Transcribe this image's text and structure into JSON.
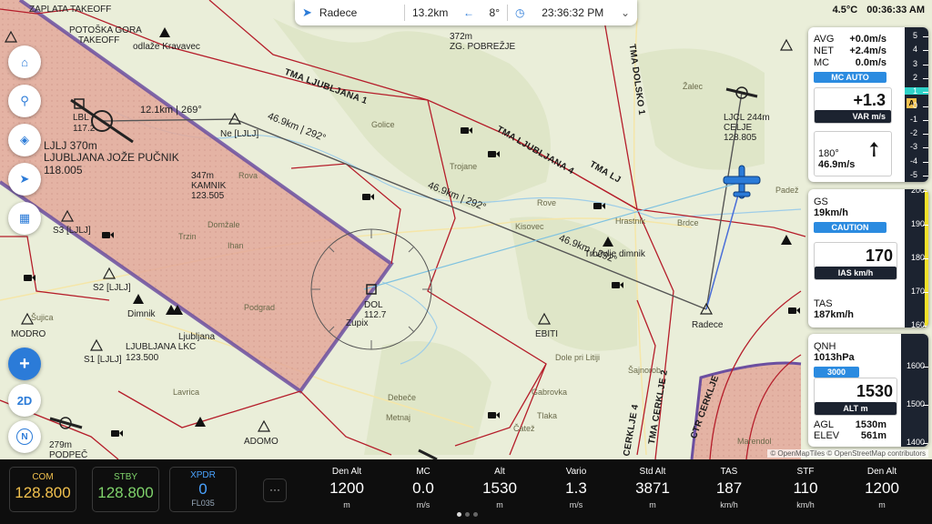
{
  "topbar": {
    "destination": "Radece",
    "distance": "13.2km",
    "bearing": "8°",
    "time": "23:36:32 PM"
  },
  "status": {
    "temperature": "4.5°C",
    "clock": "00:36:33 AM"
  },
  "map_labels": {
    "zaplata": "ZAPLATA TAKEOFF",
    "potoska": "POTOŠKA GORA",
    "potoska2": "TAKEOFF",
    "odlaze": "odlaže Kravavec",
    "lbl": "LBL",
    "lbl_freq": "117.2",
    "ljlj": "LJLJ 370m",
    "ljlj_name": "LJUBLJANA JOŽE PUČNIK",
    "ljlj_freq": "118.005",
    "ne": "Ne [LJLJ]",
    "kamnik_alt": "347m",
    "kamnik": "KAMNIK",
    "kamnik_freq": "123.505",
    "s3": "S3 [LJLJ]",
    "s2": "S2 [LJLJ]",
    "s1": "S1 [LJLJ]",
    "dimnik": "Dimnik",
    "ljubljana_lkc": "LJUBLJANA LKC",
    "ljubljana_freq": "123.500",
    "ljubljana_1": "Ljubljana",
    "modro": "MODRO",
    "podpec_alt": "279m",
    "podpec": "PODPEČ",
    "adomo": "ADOMO",
    "zg_alt": "372m",
    "zg": "ZG. POBREŽJE",
    "ljcl_alt": "LJCL 244m",
    "celje": "CELJE",
    "celje_freq": "128.805",
    "dol": "DOL",
    "dol_freq": "112.7",
    "zupix": "Zupix",
    "ebiti": "EBITI",
    "radece": "Radece",
    "trbovlje": "Trbovlje dimnik",
    "tma1": "TMA LJUBLJANA 1",
    "tma4": "TMA LJUBLJANA 4",
    "tma_lj": "TMA LJ",
    "tma_dolsko": "TMA DOLSKO 1",
    "tma_cerklje2": "TMA CERKLJE 2",
    "tma_cerklje": "CTR CERKLJE",
    "tma_cerklje4": "TMA CERKLJE 4",
    "town_golice": "Golice",
    "town_domzale": "Domžale",
    "town_trzin": "Trzin",
    "town_ihan": "Ihan",
    "town_podgrad": "Podgrad",
    "town_kisovec": "Kisovec",
    "town_hrastnik": "Hrastnik",
    "town_sevnica": "Padež",
    "town_metnaj": "Metnaj",
    "town_gabrovka": "Gabrovka",
    "town_tlaka": "Tlaka",
    "town_cater": "Čatež",
    "town_debece": "Debeče",
    "town_lavrica": "Lavrica",
    "town_sujica": "Šujica",
    "town_rova": "Rova",
    "town_rove": "Rove",
    "town_zalec": "Žalec",
    "town_marendol": "Marendol",
    "town_trojane": "Trojane",
    "town_brdce": "Brdce",
    "town_dole": "Dole pri Litiji",
    "town_sajnorob": "Šajnorob"
  },
  "route": {
    "leg1": "12.1km | 269°",
    "leg2": "46.9km | 292°",
    "leg3": "46.9km | 292°",
    "leg4": "46.9km | 292°"
  },
  "vario_panel": {
    "avg_label": "AVG",
    "avg": "+0.0m/s",
    "net_label": "NET",
    "net": "+2.4m/s",
    "mc_label": "MC",
    "mc": "0.0m/s",
    "mc_auto": "MC AUTO",
    "var_value": "+1.3",
    "var_unit": "VAR m/s",
    "wind_dir": "180°",
    "wind_speed": "46.9m/s",
    "tape": [
      "5",
      "4",
      "3",
      "2",
      "1",
      "0",
      "-1",
      "-2",
      "-3",
      "-4",
      "-5"
    ],
    "tape_marker": "A"
  },
  "speed_panel": {
    "gs_label": "GS",
    "gs": "19km/h",
    "caution": "CAUTION",
    "ias_value": "170",
    "ias_unit": "IAS km/h",
    "tas_label": "TAS",
    "tas": "187km/h",
    "tape": [
      "200",
      "190",
      "180",
      "170",
      "160"
    ]
  },
  "alt_panel": {
    "qnh_label": "QNH",
    "qnh": "1013hPa",
    "alt_bug": "3000",
    "alt_value": "1530",
    "alt_unit": "ALT m",
    "agl_label": "AGL",
    "agl": "1530m",
    "elev_label": "ELEV",
    "elev": "561m",
    "tape": [
      "1600",
      "1500",
      "1400"
    ]
  },
  "buttons": {
    "zoom_2d": "2D",
    "north": "N"
  },
  "radios": {
    "com_label": "COM",
    "com": "128.800",
    "stby_label": "STBY",
    "stby": "128.800",
    "xpdr_label": "XPDR",
    "xpdr": "0",
    "xpdr_fl": "FL035",
    "more": "···"
  },
  "metrics": [
    {
      "label": "Den Alt",
      "value": "1200",
      "unit": "m"
    },
    {
      "label": "MC",
      "value": "0.0",
      "unit": "m/s"
    },
    {
      "label": "Alt",
      "value": "1530",
      "unit": "m"
    },
    {
      "label": "Vario",
      "value": "1.3",
      "unit": "m/s"
    },
    {
      "label": "Std Alt",
      "value": "3871",
      "unit": "m"
    },
    {
      "label": "TAS",
      "value": "187",
      "unit": "km/h"
    },
    {
      "label": "STF",
      "value": "110",
      "unit": "km/h"
    },
    {
      "label": "Den Alt",
      "value": "1200",
      "unit": "m"
    }
  ],
  "attribution": "© OpenMapTiles © OpenStreetMap contributors",
  "colors": {
    "airspace_fill": "#e3a89a",
    "airspace_border_purple": "#6b4fa0",
    "tma_line": "#b51d2a",
    "accent_blue": "#2b7bd8",
    "radio_com": "#f2c14e",
    "radio_stby": "#7fd36b",
    "radio_xpdr": "#4aa3ff"
  }
}
